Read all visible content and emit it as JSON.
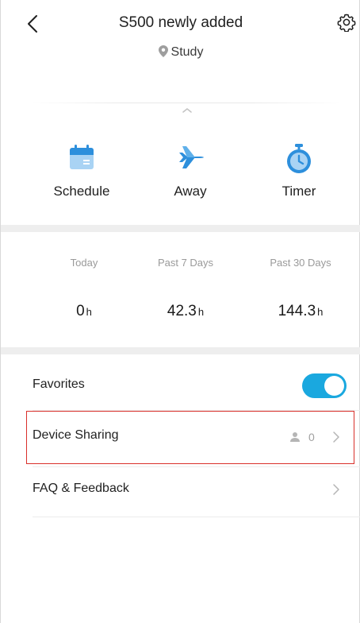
{
  "header": {
    "title": "S500 newly added",
    "location": "Study"
  },
  "actions": [
    {
      "label": "Schedule",
      "icon": "calendar-icon"
    },
    {
      "label": "Away",
      "icon": "airplane-icon"
    },
    {
      "label": "Timer",
      "icon": "stopwatch-icon"
    }
  ],
  "stats": [
    {
      "caption": "Today",
      "value": "0",
      "unit": "h"
    },
    {
      "caption": "Past 7 Days",
      "value": "42.3",
      "unit": "h"
    },
    {
      "caption": "Past 30 Days",
      "value": "144.3",
      "unit": "h"
    }
  ],
  "list": {
    "favorites_label": "Favorites",
    "favorites_on": true,
    "device_sharing_label": "Device Sharing",
    "device_sharing_count": "0",
    "faq_label": "FAQ & Feedback"
  },
  "colors": {
    "accent": "#1aa8df",
    "highlight": "#d9302b"
  }
}
